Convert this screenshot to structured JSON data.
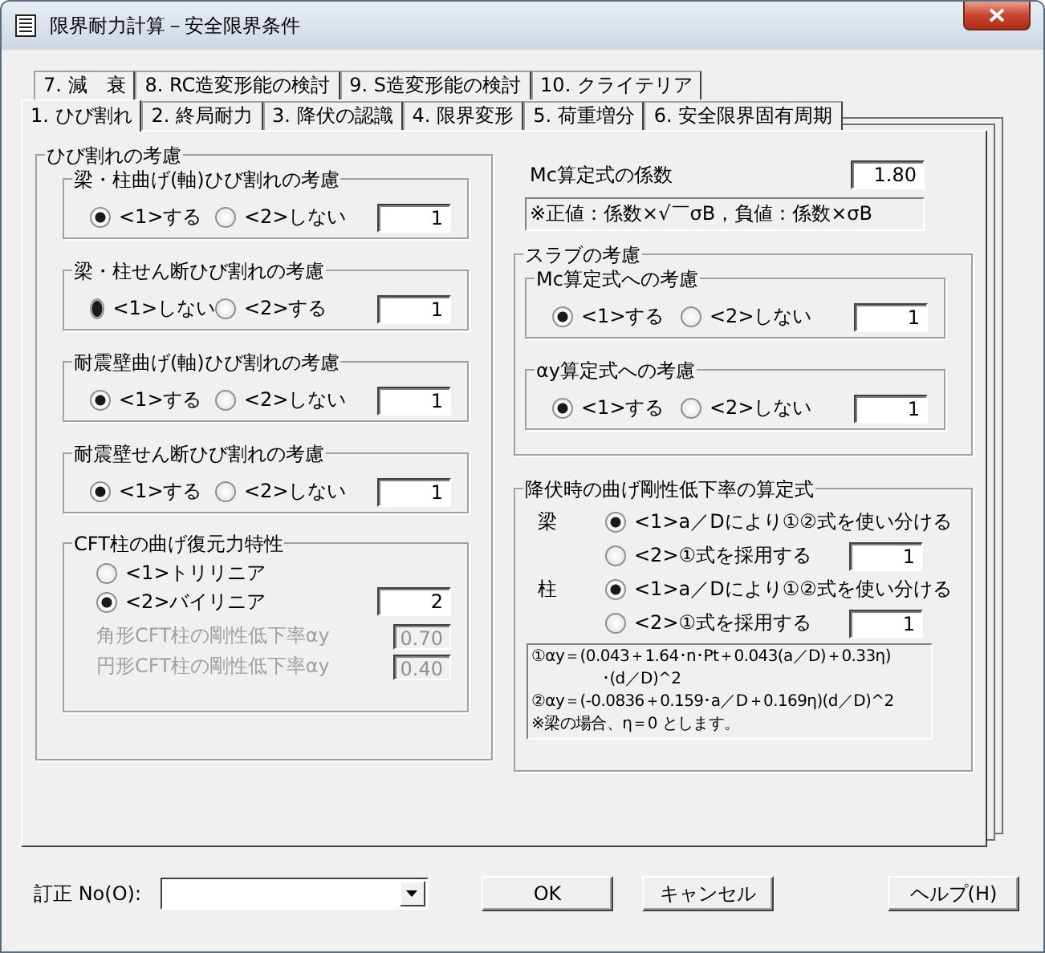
{
  "window": {
    "title": "限界耐力計算－安全限界条件"
  },
  "tabs_back": [
    {
      "label": "7. 減　衰",
      "selected": false
    },
    {
      "label": "8. RC造変形能の検討",
      "selected": false
    },
    {
      "label": "9. S造変形能の検討",
      "selected": false
    },
    {
      "label": "10. クライテリア",
      "selected": false
    }
  ],
  "tabs_front": [
    {
      "label": "1. ひび割れ",
      "selected": true
    },
    {
      "label": "2. 終局耐力",
      "selected": false
    },
    {
      "label": "3. 降伏の認識",
      "selected": false
    },
    {
      "label": "4. 限界変形",
      "selected": false
    },
    {
      "label": "5. 荷重増分",
      "selected": false
    },
    {
      "label": "6. 安全限界固有周期",
      "selected": false
    }
  ],
  "cracking": {
    "title": "ひび割れの考慮",
    "groups": [
      {
        "title": "梁・柱曲げ(軸)ひび割れの考慮",
        "options": [
          {
            "label": "<1>する",
            "selected": true
          },
          {
            "label": "<2>しない",
            "selected": false
          }
        ],
        "value": "1"
      },
      {
        "title": "梁・柱せん断ひび割れの考慮",
        "options": [
          {
            "label": "<1>しない",
            "selected": true
          },
          {
            "label": "<2>する",
            "selected": false
          }
        ],
        "value": "1"
      },
      {
        "title": "耐震壁曲げ(軸)ひび割れの考慮",
        "options": [
          {
            "label": "<1>する",
            "selected": true
          },
          {
            "label": "<2>しない",
            "selected": false
          }
        ],
        "value": "1"
      },
      {
        "title": "耐震壁せん断ひび割れの考慮",
        "options": [
          {
            "label": "<1>する",
            "selected": true
          },
          {
            "label": "<2>しない",
            "selected": false
          }
        ],
        "value": "1"
      }
    ],
    "cft": {
      "title": "CFT柱の曲げ復元力特性",
      "options": [
        {
          "label": "<1>トリリニア",
          "selected": false
        },
        {
          "label": "<2>バイリニア",
          "selected": true
        }
      ],
      "value": "2",
      "params": [
        {
          "label": "角形CFT柱の剛性低下率αy",
          "value": "0.70",
          "disabled": true
        },
        {
          "label": "円形CFT柱の剛性低下率αy",
          "value": "0.40",
          "disabled": true
        }
      ]
    }
  },
  "mc": {
    "label": "Mc算定式の係数",
    "value": "1.80",
    "note": "※正値：係数×√￣σB，負値：係数×σB"
  },
  "slab": {
    "title": "スラブの考慮",
    "groups": [
      {
        "title": "Mc算定式への考慮",
        "options": [
          {
            "label": "<1>する",
            "selected": true
          },
          {
            "label": "<2>しない",
            "selected": false
          }
        ],
        "value": "1"
      },
      {
        "title": "αy算定式への考慮",
        "options": [
          {
            "label": "<1>する",
            "selected": true
          },
          {
            "label": "<2>しない",
            "selected": false
          }
        ],
        "value": "1"
      }
    ]
  },
  "yield": {
    "title": "降伏時の曲げ剛性低下率の算定式",
    "members": [
      {
        "label": "梁",
        "options": [
          {
            "label": "<1>a／Dにより①②式を使い分ける",
            "selected": true
          },
          {
            "label": "<2>①式を採用する",
            "selected": false
          }
        ],
        "value": "1"
      },
      {
        "label": "柱",
        "options": [
          {
            "label": "<1>a／Dにより①②式を使い分ける",
            "selected": true
          },
          {
            "label": "<2>①式を採用する",
            "selected": false
          }
        ],
        "value": "1"
      }
    ],
    "formula": [
      "①αy＝(0.043＋1.64･n･Pt＋0.043(a／D)＋0.33η)",
      "･(d／D)^2",
      "②αy＝(-0.0836＋0.159･a／D＋0.169η)(d／D)^2",
      "※梁の場合、η＝0 とします。"
    ]
  },
  "footer": {
    "revision_label": "訂正 No(O):",
    "buttons": [
      "OK",
      "キャンセル",
      "ヘルプ(H)"
    ]
  }
}
